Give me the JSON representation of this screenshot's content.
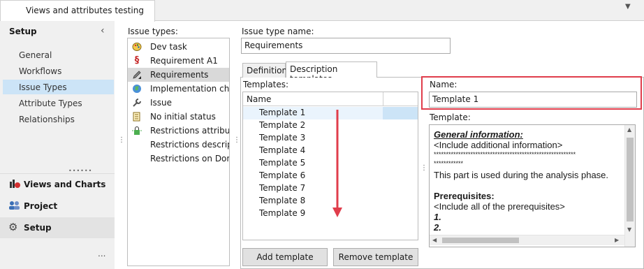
{
  "window": {
    "tab_title": "Views and attributes testing"
  },
  "sidebar": {
    "title": "Setup",
    "items": [
      {
        "label": "General"
      },
      {
        "label": "Workflows"
      },
      {
        "label": "Issue Types"
      },
      {
        "label": "Attribute Types"
      },
      {
        "label": "Relationships"
      }
    ],
    "sections": [
      {
        "label": "Views and Charts",
        "icon": "views-charts-icon"
      },
      {
        "label": "Project",
        "icon": "project-users-icon"
      },
      {
        "label": "Setup",
        "icon": "gear-icon"
      }
    ],
    "more": "..."
  },
  "issue_types": {
    "label": "Issue types:",
    "items": [
      {
        "label": "Dev task",
        "icon": "palette-icon"
      },
      {
        "label": "Requirement A1",
        "icon": "section-sign-icon"
      },
      {
        "label": "Requirements",
        "icon": "pencil-icon"
      },
      {
        "label": "Implementation change",
        "icon": "globe-icon"
      },
      {
        "label": "Issue",
        "icon": "wrench-icon"
      },
      {
        "label": "No initial status",
        "icon": "document-icon"
      },
      {
        "label": "Restrictions attributes",
        "icon": "lock-icon"
      },
      {
        "label": "Restrictions description",
        "icon": ""
      },
      {
        "label": "Restrictions on Done",
        "icon": ""
      }
    ],
    "selected": "Requirements"
  },
  "detail": {
    "type_name_label": "Issue type name:",
    "type_name_value": "Requirements",
    "tabs": [
      {
        "label": "Definition"
      },
      {
        "label": "Description templates"
      }
    ],
    "templates_label": "Templates:",
    "grid_header": "Name",
    "templates": [
      "Template 1",
      "Template 2",
      "Template 3",
      "Template 4",
      "Template 5",
      "Template 6",
      "Template 7",
      "Template 8",
      "Template 9"
    ],
    "add_button": "Add template",
    "remove_button": "Remove template",
    "name_label": "Name:",
    "name_value": "Template 1",
    "template_label": "Template:",
    "template_body": {
      "heading": "General information:",
      "line1": "<Include additional information>",
      "stars1": "**********************************************************",
      "stars2": "************",
      "line2": "This part is used during the analysis phase.",
      "heading2": "Prerequisites:",
      "line3": "<Include all of the prerequisites>",
      "item1": "1.",
      "item2": "2."
    }
  },
  "colors": {
    "highlight": "#e03d4b",
    "selection": "#cce4f7"
  }
}
